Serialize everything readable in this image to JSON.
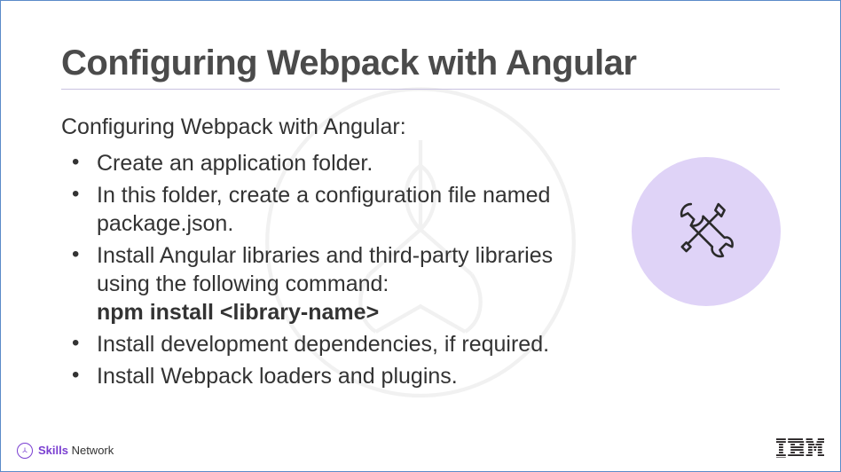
{
  "title": "Configuring Webpack with Angular",
  "intro": "Configuring Webpack with Angular:",
  "bullets": [
    {
      "text": "Create an application folder."
    },
    {
      "text": "In this folder, create a configuration file named package.json."
    },
    {
      "text": "Install Angular libraries and third-party libraries using the following command:",
      "cmd": "npm install <library-name>"
    },
    {
      "text": "Install development dependencies, if required."
    },
    {
      "text": "Install Webpack loaders and plugins."
    }
  ],
  "footer": {
    "skills_bold": "Skills",
    "skills_rest": " Network",
    "right_logo": "IBM"
  },
  "icon": {
    "name": "tools-icon",
    "bg": "#dfd3f7",
    "stroke": "#2a2a2a"
  }
}
